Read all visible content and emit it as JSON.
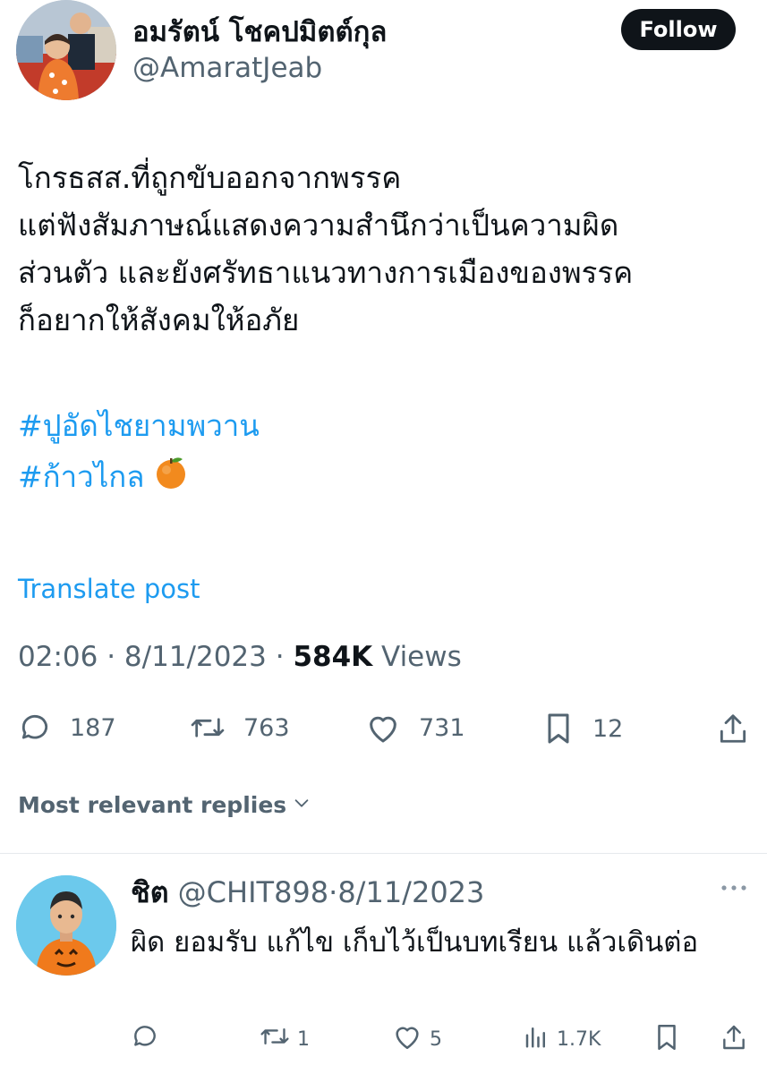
{
  "tweet": {
    "author_name": "อมรัตน์ โชคปมิตต์กุล",
    "author_handle": "@AmaratJeab",
    "follow_label": "Follow",
    "body_lines": [
      "โกรธสส.ที่ถูกขับออกจากพรรค",
      "แต่ฟังสัมภาษณ์แสดงความสำนึกว่าเป็นความผิด",
      "ส่วนตัว และยังศรัทธาแนวทางการเมืองของพรรค",
      "ก็อยากให้สังคมให้อภัย"
    ],
    "hashtags": [
      "#ปูอัดไชยามพวาน",
      "#ก้าวไกล"
    ],
    "emoji_icon": "orange-emoji",
    "translate_label": "Translate post",
    "time": "02:06",
    "date": "8/11/2023",
    "views_count": "584K",
    "views_label": "Views",
    "stats": {
      "replies": "187",
      "reposts": "763",
      "likes": "731",
      "bookmarks": "12"
    }
  },
  "replies_header": "Most relevant replies",
  "reply": {
    "name": "ชิต",
    "handle": "@CHIT898",
    "date": "8/11/2023",
    "text": "ผิด ยอมรับ แก้ไข เก็บไว้เป็นบทเรียน แล้วเดินต่อ",
    "stats": {
      "replies": "",
      "reposts": "1",
      "likes": "5",
      "views": "1.7K"
    }
  },
  "colors": {
    "accent": "#1d9bf0",
    "text": "#0f1419",
    "muted": "#536471"
  }
}
